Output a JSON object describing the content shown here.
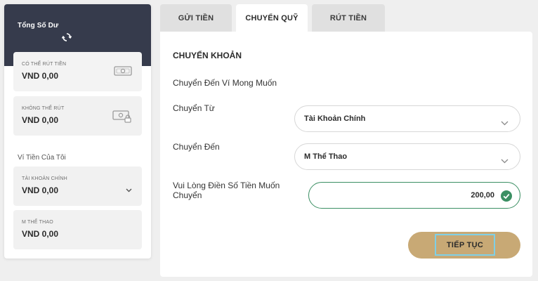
{
  "wallet": {
    "title": "Tổng Số Dư",
    "refresh_icon": "refresh-icon",
    "withdrawable": {
      "label": "CÓ THỂ RÚT TIỀN",
      "value": "VND  0,00",
      "icon": "cash-icon"
    },
    "non_withdrawable": {
      "label": "KHÔNG THỂ RÚT",
      "value": "VND  0,00",
      "icon": "cash-lock-icon"
    },
    "my_wallets_label": "Ví Tiền Của Tôi",
    "main_account": {
      "label": "TÀI KHOẢN CHÍNH",
      "value": "VND  0,00",
      "icon": "chevron-down-icon"
    },
    "sports": {
      "label": "M THỂ THAO",
      "value": "VND  0,00"
    }
  },
  "tabs": [
    {
      "label": "GỬI TIỀN",
      "active": false
    },
    {
      "label": "CHUYỂN QUỸ",
      "active": true
    },
    {
      "label": "RÚT TIỀN",
      "active": false
    }
  ],
  "form": {
    "heading": "CHUYỂN KHOẢN",
    "subheading": "Chuyển Đến Ví Mong Muốn",
    "from": {
      "label": "Chuyển Từ",
      "value": "Tài Khoản Chính"
    },
    "to": {
      "label": "Chuyển Đến",
      "value": "M Thể Thao"
    },
    "amount": {
      "label_line1": "Vui Lòng Điền Số Tiền Muốn",
      "label_line2": "Chuyển",
      "value": "200,00"
    },
    "continue_label": "TIẾP TỤC"
  },
  "colors": {
    "header_dark": "#363b4c",
    "accent_gold": "#c8a975",
    "valid_green": "#3b8f63",
    "focus_outline": "#7fd0e6"
  }
}
